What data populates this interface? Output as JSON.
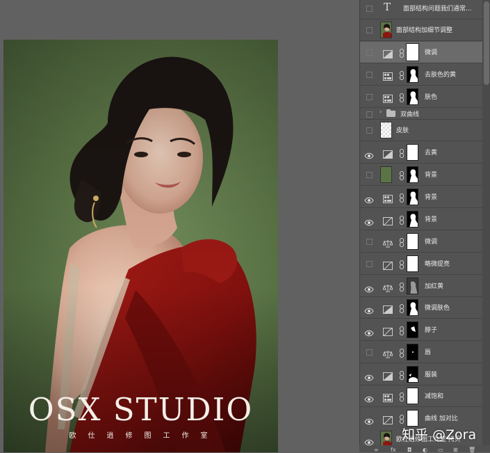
{
  "photo": {
    "watermark_title": "OSX STUDIO",
    "watermark_subtitle": "欧仕逍修图工作室"
  },
  "layers": [
    {
      "name": "面部结构问题我们通常...",
      "kind": "text",
      "visible": false
    },
    {
      "name": "面部结构加细节调整",
      "kind": "image",
      "visible": false
    },
    {
      "name": "微调",
      "kind": "adjust-bw",
      "visible": false,
      "selected": true,
      "mask": "white"
    },
    {
      "name": "去肤色的黄",
      "kind": "adjust-hsl",
      "visible": false,
      "mask": "silhouette"
    },
    {
      "name": "肤色",
      "kind": "adjust-hsl",
      "visible": false,
      "mask": "silhouette"
    },
    {
      "name": "双曲线",
      "kind": "group",
      "visible": false
    },
    {
      "name": "皮肤",
      "kind": "pixel",
      "visible": false
    },
    {
      "name": "去黄",
      "kind": "adjust-bw",
      "visible": true,
      "mask": "white"
    },
    {
      "name": "背景",
      "kind": "fill-green",
      "visible": false,
      "mask": "silhouette"
    },
    {
      "name": "背景",
      "kind": "adjust-hsl",
      "visible": true,
      "mask": "silhouette"
    },
    {
      "name": "背景",
      "kind": "adjust-curves",
      "visible": true,
      "mask": "silhouette"
    },
    {
      "name": "微调",
      "kind": "adjust-balance",
      "visible": false,
      "mask": "white"
    },
    {
      "name": "略微提亮",
      "kind": "adjust-curves",
      "visible": false,
      "mask": "white"
    },
    {
      "name": "加红黄",
      "kind": "adjust-balance",
      "visible": true,
      "mask": "gray"
    },
    {
      "name": "微调肤色",
      "kind": "adjust-bw",
      "visible": true,
      "mask": "silhouette"
    },
    {
      "name": "脖子",
      "kind": "adjust-curves",
      "visible": true,
      "mask": "neck"
    },
    {
      "name": "唇",
      "kind": "adjust-balance",
      "visible": false,
      "mask": "black"
    },
    {
      "name": "服装",
      "kind": "adjust-bw",
      "visible": true,
      "mask": "dress"
    },
    {
      "name": "减饱和",
      "kind": "adjust-hsl",
      "visible": true,
      "mask": "white"
    },
    {
      "name": "曲线 加对比",
      "kind": "adjust-curves",
      "visible": true,
      "mask": "white"
    },
    {
      "name": "欧仕逍修图工作室 拷贝",
      "kind": "image",
      "visible": true
    }
  ],
  "watermark_site": "知乎 @Zora",
  "colors": {
    "panel_bg": "#535353",
    "selected_row": "#6b6b6b",
    "canvas_bg": "#616161",
    "backdrop_green": "#5b7446",
    "dress_red": "#8e1512"
  }
}
